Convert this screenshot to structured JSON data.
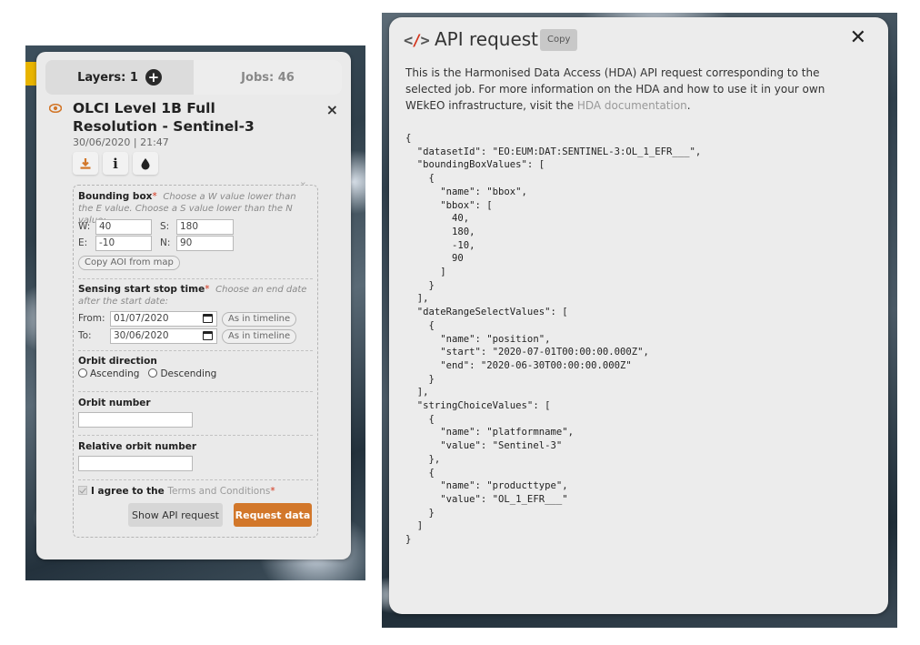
{
  "left_panel": {
    "tabs": [
      {
        "label": "Layers: 1"
      },
      {
        "label": "Jobs: 46"
      }
    ],
    "layer": {
      "title": "OLCI Level 1B Full Resolution - Sentinel-3",
      "date": "30/06/2020 | 21:47",
      "close": "×",
      "tools": [
        "download-icon",
        "info-icon",
        "drop-icon"
      ]
    },
    "form": {
      "bbox": {
        "label": "Bounding box",
        "required_mark": "*",
        "hint": "Choose a W value lower than the E value. Choose a S value lower than the N value:",
        "w_label": "W:",
        "w_value": "40",
        "s_label": "S:",
        "s_value": "180",
        "e_label": "E:",
        "e_value": "-10",
        "n_label": "N:",
        "n_value": "90",
        "copy_aoi": "Copy AOI from map"
      },
      "sensing": {
        "label": "Sensing start stop time",
        "required_mark": "*",
        "hint": "Choose an end date after the start date:",
        "from_label": "From:",
        "from_value": "01/07/2020",
        "to_label": "To:",
        "to_value": "30/06/2020",
        "as_timeline": "As in timeline"
      },
      "orbit_direction": {
        "label": "Orbit direction",
        "options": [
          "Ascending",
          "Descending"
        ]
      },
      "orbit_number": {
        "label": "Orbit number",
        "value": ""
      },
      "relative_orbit": {
        "label": "Relative orbit number",
        "value": ""
      },
      "terms": {
        "prefix": "I agree to the ",
        "link": "Terms and Conditions",
        "required_mark": "*"
      },
      "show_api": "Show API request",
      "request_data": "Request data"
    }
  },
  "api_modal": {
    "title": "API request",
    "copy": "Copy",
    "close": "✕",
    "desc_text": "This is the Harmonised Data Access (HDA) API request corresponding to the selected job. For more information on the HDA and how to use it in your own WEkEO infrastructure, visit the ",
    "desc_link": "HDA documentation",
    "desc_end": ".",
    "code": "{\n  \"datasetId\": \"EO:EUM:DAT:SENTINEL-3:OL_1_EFR___\",\n  \"boundingBoxValues\": [\n    {\n      \"name\": \"bbox\",\n      \"bbox\": [\n        40,\n        180,\n        -10,\n        90\n      ]\n    }\n  ],\n  \"dateRangeSelectValues\": [\n    {\n      \"name\": \"position\",\n      \"start\": \"2020-07-01T00:00:00.000Z\",\n      \"end\": \"2020-06-30T00:00:00.000Z\"\n    }\n  ],\n  \"stringChoiceValues\": [\n    {\n      \"name\": \"platformname\",\n      \"value\": \"Sentinel-3\"\n    },\n    {\n      \"name\": \"producttype\",\n      \"value\": \"OL_1_EFR___\"\n    }\n  ]\n}"
  },
  "colors": {
    "accent_orange": "#d2772a",
    "required_red": "#d3331a",
    "panel_bg": "#eaeaea"
  }
}
